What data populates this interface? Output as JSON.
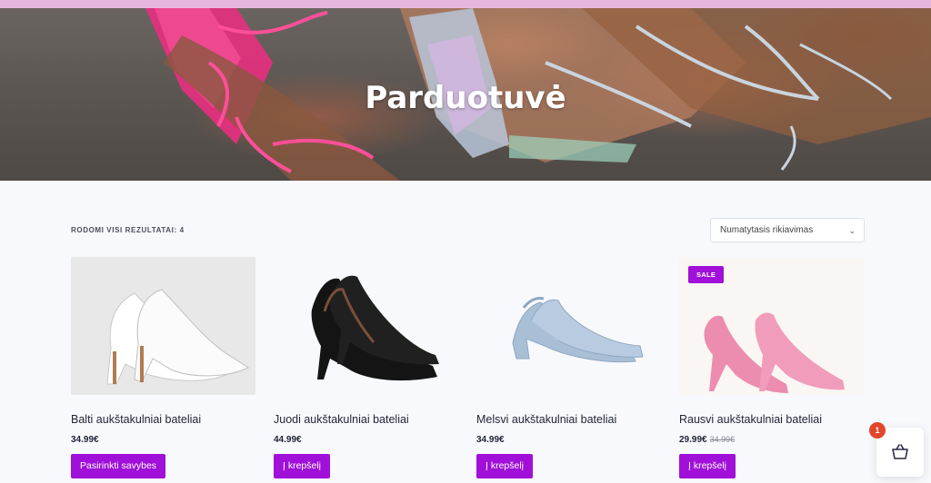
{
  "hero": {
    "title": "Parduotuvė"
  },
  "toolbar": {
    "results_text": "RODOMI VISI REZULTATAI: 4",
    "sort_selected": "Numatytasis rikiavimas"
  },
  "products": [
    {
      "name": "Balti aukštakulniai bateliai",
      "price": "34.99€",
      "button": "Pasirinkti savybes"
    },
    {
      "name": "Juodi aukštakulniai bateliai",
      "price": "44.99€",
      "button": "Į krepšelį"
    },
    {
      "name": "Melsvi aukštakulniai bateliai",
      "price": "34.99€",
      "button": "Į krepšelį"
    },
    {
      "name": "Rausvi aukštakulniai bateliai",
      "price": "29.99€",
      "old_price": "34.99€",
      "sale_badge": "SALE",
      "button": "Į krepšelį"
    }
  ],
  "cart": {
    "count": "1",
    "icon": "basket-icon"
  },
  "colors": {
    "accent": "#a010d8",
    "badge": "#e3452c",
    "topbar": "#e7b6e0"
  }
}
